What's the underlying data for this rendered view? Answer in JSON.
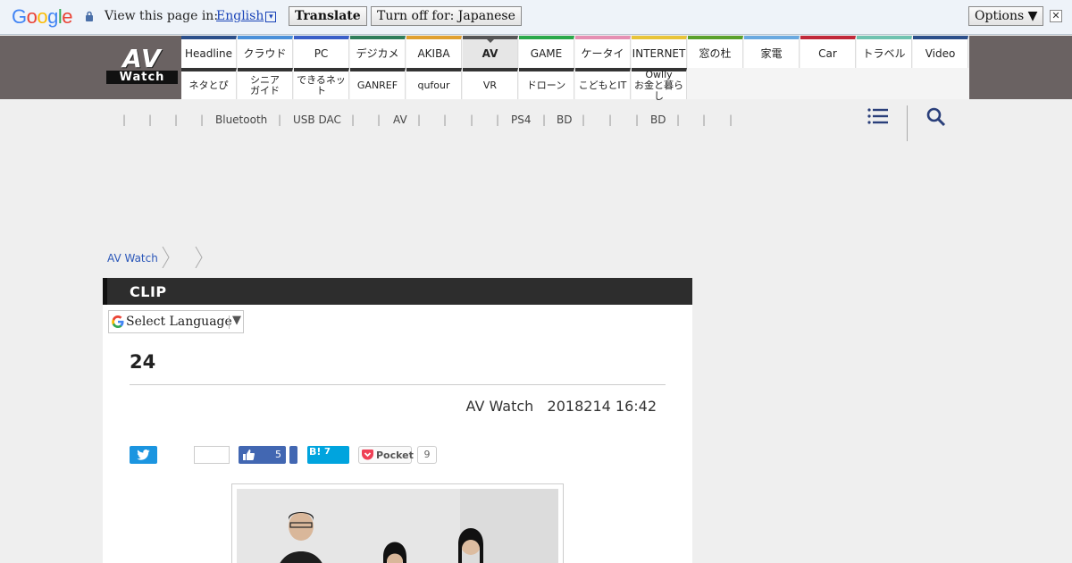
{
  "translate_bar": {
    "brand": "Google",
    "prompt": "View this page in:",
    "language": "English",
    "translate_label": "Translate",
    "turn_off_label": "Turn off for: Japanese",
    "options_label": "Options ▼",
    "close_glyph": "✕"
  },
  "site": {
    "logo_top": "AV",
    "logo_bottom": "Watch",
    "nav_row1": [
      {
        "label": "Headline",
        "color": "#2b4f8a"
      },
      {
        "label": "クラウド",
        "color": "#4a90d9"
      },
      {
        "label": "PC",
        "color": "#3a5fc8"
      },
      {
        "label": "デジカメ",
        "color": "#2e7d5a"
      },
      {
        "label": "AKIBA",
        "color": "#e0a030"
      },
      {
        "label": "AV",
        "color": "#555555",
        "selected": true
      },
      {
        "label": "GAME",
        "color": "#2aa84a"
      },
      {
        "label": "ケータイ",
        "color": "#e58fb3"
      },
      {
        "label": "INTERNET",
        "color": "#e8c43a"
      },
      {
        "label": "窓の杜",
        "color": "#5aa02c"
      },
      {
        "label": "家電",
        "color": "#6aa9e0"
      },
      {
        "label": "Car",
        "color": "#c0283a"
      },
      {
        "label": "トラベル",
        "color": "#6fc2b0"
      },
      {
        "label": "Video",
        "color": "#2b4f8a"
      }
    ],
    "nav_row2": [
      {
        "label": "ネタとぴ"
      },
      {
        "label": "シニア\nガイド"
      },
      {
        "label": "できるネット"
      },
      {
        "label": "GANREF"
      },
      {
        "label": "qufour"
      },
      {
        "label": "VR"
      },
      {
        "label": "ドローン"
      },
      {
        "label": "こどもとIT"
      },
      {
        "label": "Owlly\nお金と暮らし"
      }
    ],
    "subnav": [
      "Bluetooth",
      "USB DAC",
      "AV",
      "PS4",
      "BD",
      "BD"
    ],
    "breadcrumb": "AV Watch"
  },
  "article": {
    "section": "CLIP",
    "select_language": "Select Language",
    "title": "24",
    "byline": "AV Watch   2018214 16:42",
    "share": {
      "like_count": "5",
      "hatena_label": "B!",
      "hatena_count": "7",
      "pocket_label": "Pocket",
      "pocket_count": "9"
    }
  },
  "colors": {
    "nav_bg": "#6a6262",
    "section_bar": "#2d2d2d",
    "link": "#2b57b9",
    "twitter": "#1b95e0",
    "facebook": "#3b5998",
    "hatena": "#00a4de",
    "pocket": "#ef4056"
  }
}
